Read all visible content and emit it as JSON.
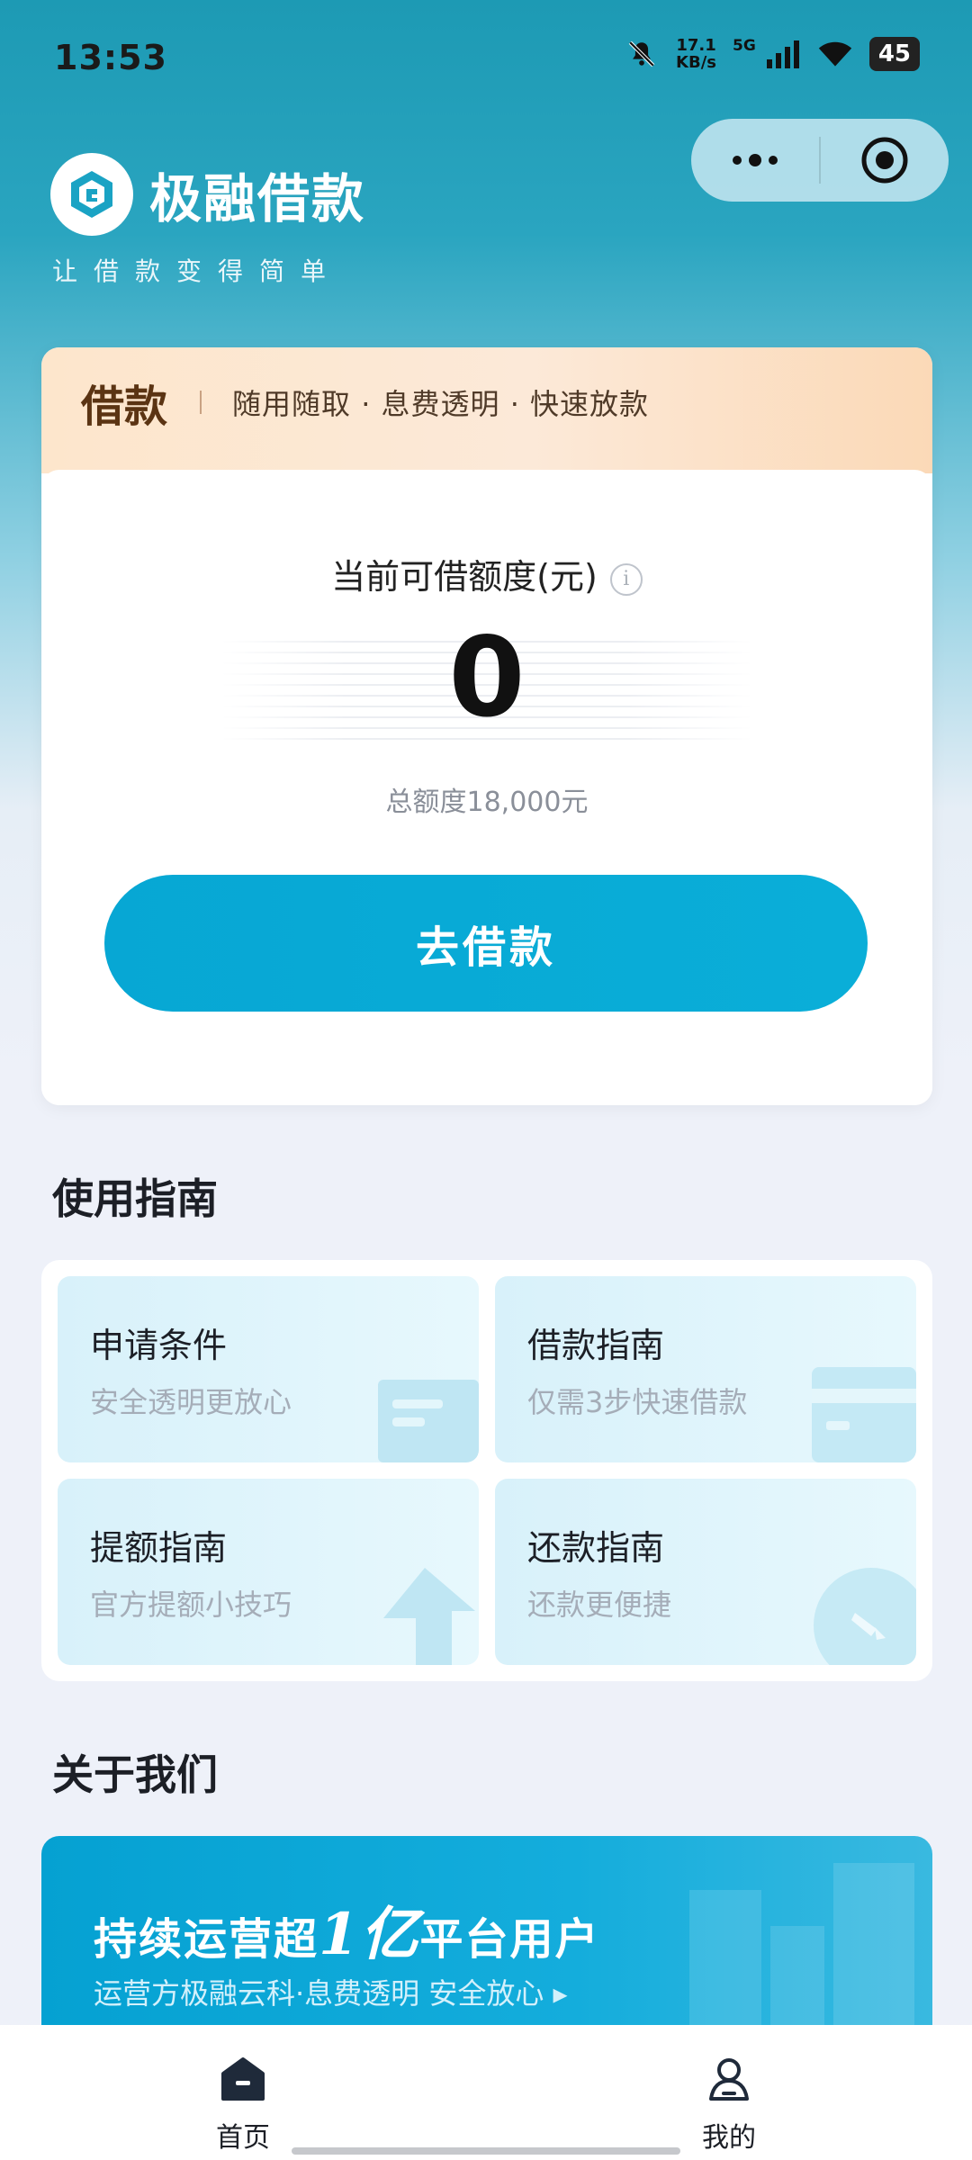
{
  "status_bar": {
    "time": "13:53",
    "net_speed_value": "17.1",
    "net_speed_unit": "KB/s",
    "network": "5G",
    "battery": "45",
    "icons": [
      "bell-off-icon",
      "signal-icon",
      "wifi-icon",
      "battery-icon"
    ]
  },
  "header": {
    "app_title": "极融借款",
    "slogan": "让借款变得简单",
    "logo_icon": "jirong-logo-icon",
    "capsule_icons": [
      "more-icon",
      "close-target-icon"
    ]
  },
  "loan": {
    "title": "借款",
    "features": "随用随取 · 息费透明 · 快速放款",
    "limit_label": "当前可借额度(元)",
    "info_icon": "info-icon",
    "amount": "0",
    "total": "总额度18,000元",
    "button": "去借款"
  },
  "guide": {
    "section_title": "使用指南",
    "items": [
      {
        "title": "申请条件",
        "subtitle": "安全透明更放心"
      },
      {
        "title": "借款指南",
        "subtitle": "仅需3步快速借款"
      },
      {
        "title": "提额指南",
        "subtitle": "官方提额小技巧"
      },
      {
        "title": "还款指南",
        "subtitle": "还款更便捷"
      }
    ]
  },
  "about": {
    "section_title": "关于我们",
    "banner_title_pre": "持续运营超",
    "banner_title_big": "1亿",
    "banner_title_post": "平台用户",
    "banner_sub": "运营方极融云科·息费透明 安全放心 ▸"
  },
  "tabbar": {
    "tabs": [
      {
        "label": "首页",
        "icon": "home-icon",
        "active": true
      },
      {
        "label": "我的",
        "icon": "profile-icon",
        "active": false
      }
    ]
  },
  "colors": {
    "primary": "#0aaed8",
    "header_bg": "#1d9ab4",
    "loan_head_bg": "#fde6cc",
    "loan_title": "#5b3413"
  }
}
